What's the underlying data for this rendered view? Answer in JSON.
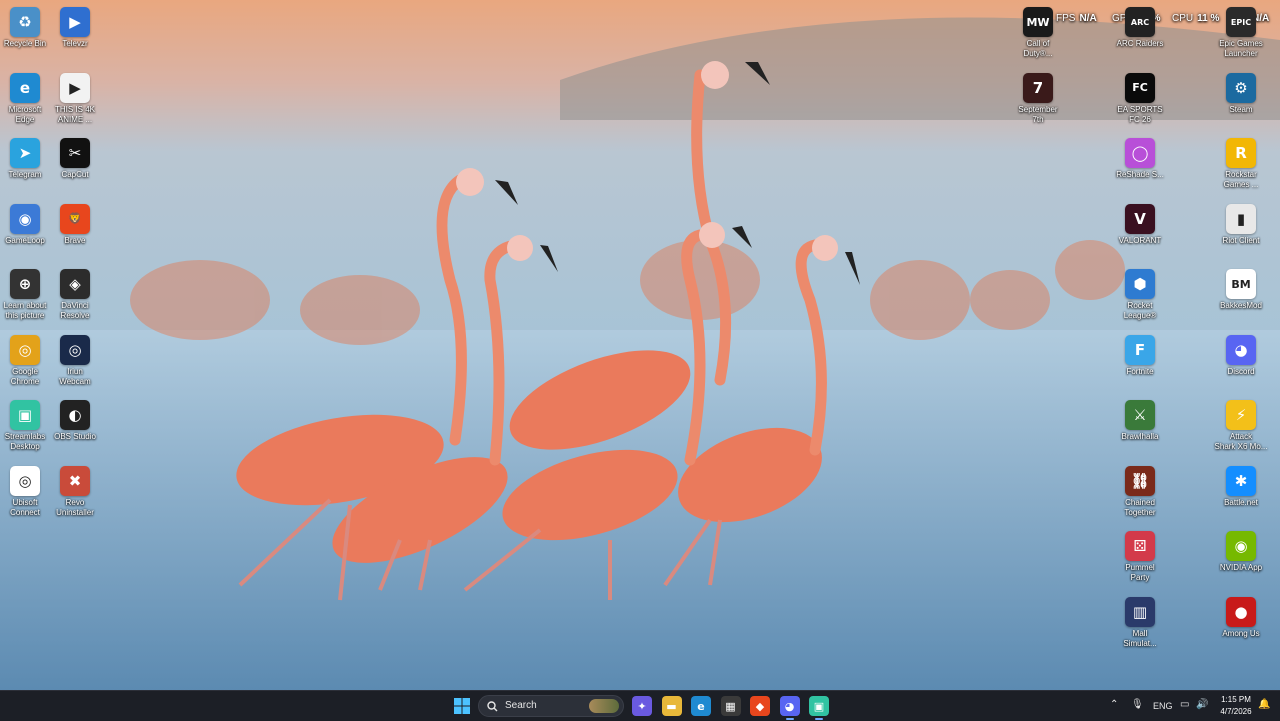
{
  "overlay": {
    "fps_label": "FPS",
    "fps_value": "N/A",
    "gpu_label": "GPU",
    "gpu_value": "22 %",
    "cpu_label": "CPU",
    "cpu_value": "11 %",
    "extra_value": "N/A"
  },
  "desktop_left": [
    {
      "label": "Recycle Bin",
      "icon": "recycle-bin-icon",
      "color": "#4a90c8",
      "glyph": "♻"
    },
    {
      "label": "Televzr",
      "icon": "televzr-icon",
      "color": "#2f6fd0",
      "glyph": "▶"
    },
    {
      "label": "Microsoft\nEdge",
      "icon": "edge-icon",
      "color": "#1f8ad1",
      "glyph": "e"
    },
    {
      "label": "THIS IS 4K\nANIME ...",
      "icon": "anime-file-icon",
      "color": "#f2f2f2",
      "glyph": "▶"
    },
    {
      "label": "Telegram",
      "icon": "telegram-icon",
      "color": "#2aa3de",
      "glyph": "➤"
    },
    {
      "label": "CapCut",
      "icon": "capcut-icon",
      "color": "#111111",
      "glyph": "✂"
    },
    {
      "label": "GameLoop",
      "icon": "gameloop-icon",
      "color": "#3c7ad6",
      "glyph": "◉"
    },
    {
      "label": "Brave",
      "icon": "brave-icon",
      "color": "#e8461d",
      "glyph": "🦁"
    },
    {
      "label": "Learn about\nthis picture",
      "icon": "learn-picture-icon",
      "color": "#333333",
      "glyph": "⊕"
    },
    {
      "label": "DaVinci\nResolve",
      "icon": "davinci-icon",
      "color": "#2c2c2c",
      "glyph": "◈"
    },
    {
      "label": "Google\nChrome",
      "icon": "chrome-icon",
      "color": "#e3a21a",
      "glyph": "◎"
    },
    {
      "label": "Iriun\nWebcam",
      "icon": "iriun-webcam-icon",
      "color": "#1a2a4a",
      "glyph": "◎"
    },
    {
      "label": "Streamlabs\nDesktop",
      "icon": "streamlabs-icon",
      "color": "#31c3a2",
      "glyph": "▣"
    },
    {
      "label": "OBS Studio",
      "icon": "obs-icon",
      "color": "#222222",
      "glyph": "◐"
    },
    {
      "label": "Ubisoft\nConnect",
      "icon": "ubisoft-icon",
      "color": "#ffffff",
      "glyph": "◎"
    },
    {
      "label": "Revo\nUninstaller",
      "icon": "revo-uninstaller-icon",
      "color": "#c94b3a",
      "glyph": "✖"
    }
  ],
  "desktop_right": [
    {
      "label": "Call of\nDuty®...",
      "icon": "call-of-duty-icon",
      "color": "#1a1a1a",
      "glyph": "MW"
    },
    {
      "label": "ARC Raiders",
      "icon": "arc-raiders-icon",
      "color": "#222222",
      "glyph": "ARC"
    },
    {
      "label": "Epic Games\nLauncher",
      "icon": "epic-games-icon",
      "color": "#2a2a2a",
      "glyph": "EPIC"
    },
    {
      "label": "September\n7th",
      "icon": "september-7th-icon",
      "color": "#3a1a1a",
      "glyph": "7"
    },
    {
      "label": "EA SPORTS\nFC 26",
      "icon": "ea-fc-icon",
      "color": "#0a0a0a",
      "glyph": "FC"
    },
    {
      "label": "Steam",
      "icon": "steam-icon",
      "color": "#1b6aa0",
      "glyph": "⚙"
    },
    {
      "label": "ReShade S...",
      "icon": "reshade-icon",
      "color": "#b84fd8",
      "glyph": "◯"
    },
    {
      "label": "Rockstar\nGames ...",
      "icon": "rockstar-icon",
      "color": "#f2b705",
      "glyph": "R"
    },
    {
      "label": "VALORANT",
      "icon": "valorant-icon",
      "color": "#3a1020",
      "glyph": "V"
    },
    {
      "label": "Riot Client",
      "icon": "riot-client-icon",
      "color": "#e8e8e8",
      "glyph": "▮"
    },
    {
      "label": "Rocket\nLeague®",
      "icon": "rocket-league-icon",
      "color": "#2e7bd1",
      "glyph": "⬢"
    },
    {
      "label": "BakkesMod",
      "icon": "bakkesmod-icon",
      "color": "#ffffff",
      "glyph": "BM"
    },
    {
      "label": "Fortnite",
      "icon": "fortnite-icon",
      "color": "#3aa6e8",
      "glyph": "F"
    },
    {
      "label": "Discord",
      "icon": "discord-icon",
      "color": "#5865f2",
      "glyph": "◕"
    },
    {
      "label": "Brawlhalla",
      "icon": "brawlhalla-icon",
      "color": "#3a7a3a",
      "glyph": "⚔"
    },
    {
      "label": "Attack\nShark X6 Mo...",
      "icon": "attack-shark-icon",
      "color": "#f3c019",
      "glyph": "⚡"
    },
    {
      "label": "Chained\nTogether",
      "icon": "chained-together-icon",
      "color": "#7a2a1a",
      "glyph": "⛓"
    },
    {
      "label": "Battle.net",
      "icon": "battlenet-icon",
      "color": "#148eff",
      "glyph": "✱"
    },
    {
      "label": "Pummel\nParty",
      "icon": "pummel-party-icon",
      "color": "#d33a4a",
      "glyph": "⚄"
    },
    {
      "label": "NVIDIA App",
      "icon": "nvidia-icon",
      "color": "#76b900",
      "glyph": "◉"
    },
    {
      "label": "Mall\nSimulat...",
      "icon": "mall-simulator-icon",
      "color": "#2a3a6a",
      "glyph": "▥"
    },
    {
      "label": "Among Us",
      "icon": "among-us-icon",
      "color": "#c81a1a",
      "glyph": "●"
    }
  ],
  "taskbar": {
    "search_placeholder": "Search",
    "apps": [
      {
        "name": "copilot-taskbar-icon",
        "color": "#6a5ae0",
        "glyph": "✦"
      },
      {
        "name": "file-explorer-taskbar-icon",
        "color": "#e8b83a",
        "glyph": "▬"
      },
      {
        "name": "edge-taskbar-icon",
        "color": "#1f8ad1",
        "glyph": "e"
      },
      {
        "name": "store-taskbar-icon",
        "color": "#3a3a3a",
        "glyph": "▦"
      },
      {
        "name": "brave-taskbar-icon",
        "color": "#e8461d",
        "glyph": "◆"
      },
      {
        "name": "discord-taskbar-icon",
        "color": "#5865f2",
        "glyph": "◕"
      },
      {
        "name": "streamlabs-taskbar-icon",
        "color": "#31c3a2",
        "glyph": "▣"
      }
    ],
    "language": "ENG",
    "time": "1:15 PM",
    "date": "4/7/2026"
  }
}
